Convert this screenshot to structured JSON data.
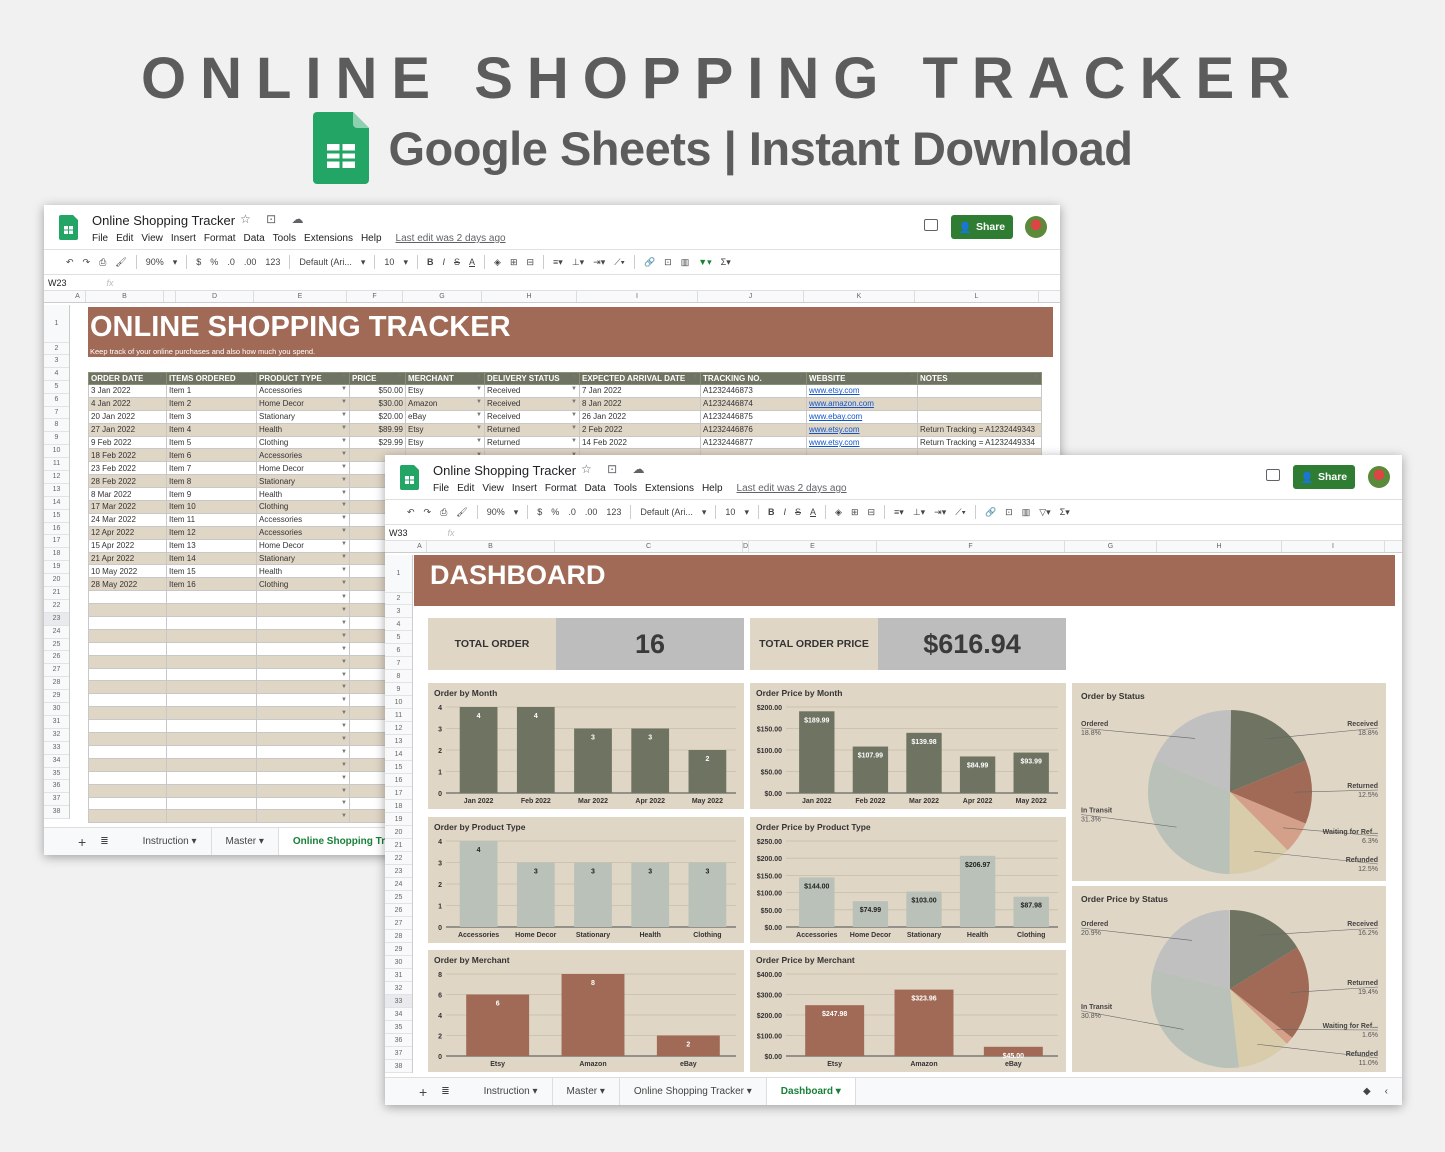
{
  "promo": {
    "title": "ONLINE SHOPPING TRACKER",
    "subtitle": "Google Sheets | Instant Download"
  },
  "window_back": {
    "doc_title": "Online Shopping Tracker",
    "menu": [
      "File",
      "Edit",
      "View",
      "Insert",
      "Format",
      "Data",
      "Tools",
      "Extensions",
      "Help"
    ],
    "last_edit": "Last edit was 2 days ago",
    "share_label": "Share",
    "toolbar": {
      "zoom": "90%",
      "currency": "$",
      "percent": "%",
      "dec_less": ".0",
      "dec_more": ".00",
      "format": "123",
      "font": "Default (Ari...",
      "font_size": "10"
    },
    "cell_ref": "W23",
    "columns": [
      "A",
      "B",
      "",
      "D",
      "E",
      "F",
      "G",
      "H",
      "I",
      "J",
      "K",
      "L"
    ],
    "banner_title": "ONLINE SHOPPING TRACKER",
    "banner_subtitle": "Keep track of your online purchases and also how much you spend.",
    "table_headers": [
      "ORDER DATE",
      "ITEMS ORDERED",
      "PRODUCT TYPE",
      "PRICE",
      "MERCHANT",
      "DELIVERY STATUS",
      "EXPECTED ARRIVAL DATE",
      "TRACKING NO.",
      "WEBSITE",
      "NOTES"
    ],
    "rows": [
      [
        "3 Jan 2022",
        "Item 1",
        "Accessories",
        "$50.00",
        "Etsy",
        "Received",
        "7 Jan 2022",
        "A1232446873",
        "www.etsy.com",
        ""
      ],
      [
        "4 Jan 2022",
        "Item 2",
        "Home Decor",
        "$30.00",
        "Amazon",
        "Received",
        "8 Jan 2022",
        "A1232446874",
        "www.amazon.com",
        ""
      ],
      [
        "20 Jan 2022",
        "Item 3",
        "Stationary",
        "$20.00",
        "eBay",
        "Received",
        "26 Jan 2022",
        "A1232446875",
        "www.ebay.com",
        ""
      ],
      [
        "27 Jan 2022",
        "Item 4",
        "Health",
        "$89.99",
        "Etsy",
        "Returned",
        "2 Feb 2022",
        "A1232446876",
        "www.etsy.com",
        "Return Tracking = A1232449343"
      ],
      [
        "9 Feb 2022",
        "Item 5",
        "Clothing",
        "$29.99",
        "Etsy",
        "Returned",
        "14 Feb 2022",
        "A1232446877",
        "www.etsy.com",
        "Return Tracking = A1232449334"
      ],
      [
        "18 Feb 2022",
        "Item 6",
        "Accessories",
        "",
        "",
        "",
        "",
        "",
        "",
        ""
      ],
      [
        "23 Feb 2022",
        "Item 7",
        "Home Decor",
        "",
        "",
        "",
        "",
        "",
        "",
        ""
      ],
      [
        "28 Feb 2022",
        "Item 8",
        "Stationary",
        "",
        "",
        "",
        "",
        "",
        "",
        ""
      ],
      [
        "8 Mar 2022",
        "Item 9",
        "Health",
        "",
        "",
        "",
        "",
        "",
        "",
        ""
      ],
      [
        "17 Mar 2022",
        "Item 10",
        "Clothing",
        "",
        "",
        "",
        "",
        "",
        "",
        ""
      ],
      [
        "24 Mar 2022",
        "Item 11",
        "Accessories",
        "",
        "",
        "",
        "",
        "",
        "",
        ""
      ],
      [
        "12 Apr 2022",
        "Item 12",
        "Accessories",
        "",
        "",
        "",
        "",
        "",
        "",
        ""
      ],
      [
        "15 Apr 2022",
        "Item 13",
        "Home Decor",
        "",
        "",
        "",
        "",
        "",
        "",
        ""
      ],
      [
        "21 Apr 2022",
        "Item 14",
        "Stationary",
        "",
        "",
        "",
        "",
        "",
        "",
        ""
      ],
      [
        "10 May 2022",
        "Item 15",
        "Health",
        "",
        "",
        "",
        "",
        "",
        "",
        ""
      ],
      [
        "28 May 2022",
        "Item 16",
        "Clothing",
        "",
        "",
        "",
        "",
        "",
        "",
        ""
      ]
    ],
    "sheet_tabs": [
      "Instruction",
      "Master",
      "Online Shopping Trac"
    ]
  },
  "window_front": {
    "doc_title": "Online Shopping Tracker",
    "menu": [
      "File",
      "Edit",
      "View",
      "Insert",
      "Format",
      "Data",
      "Tools",
      "Extensions",
      "Help"
    ],
    "last_edit": "Last edit was 2 days ago",
    "share_label": "Share",
    "toolbar": {
      "zoom": "90%",
      "currency": "$",
      "percent": "%",
      "dec_less": ".0",
      "dec_more": ".00",
      "format": "123",
      "font": "Default (Ari...",
      "font_size": "10"
    },
    "cell_ref": "W33",
    "columns": [
      "A",
      "B",
      "C",
      "D",
      "E",
      "F",
      "G",
      "H",
      "I"
    ],
    "dashboard_title": "DASHBOARD",
    "kpis": {
      "total_order_label": "TOTAL ORDER",
      "total_order_value": "16",
      "total_price_label": "TOTAL ORDER PRICE",
      "total_price_value": "$616.94"
    },
    "sheet_tabs": [
      "Instruction",
      "Master",
      "Online Shopping Tracker",
      "Dashboard"
    ],
    "active_tab": "Dashboard"
  },
  "colors": {
    "brand_brown": "#a06a56",
    "olive": "#6e7362",
    "sage": "#b9c1b8",
    "beige_bg": "#e0d6c6",
    "share_green": "#2e7d32"
  },
  "chart_data": [
    {
      "type": "bar",
      "title": "Order by Month",
      "categories": [
        "Jan 2022",
        "Feb 2022",
        "Mar 2022",
        "Apr 2022",
        "May 2022"
      ],
      "values": [
        4,
        4,
        3,
        3,
        2
      ],
      "labels": [
        "4",
        "4",
        "3",
        "3",
        "2"
      ],
      "yticks": [
        "0",
        "1",
        "2",
        "3",
        "4"
      ],
      "ylim": [
        0,
        4
      ],
      "color": "#6e7362",
      "label_color": "#ffffff"
    },
    {
      "type": "bar",
      "title": "Order Price by Month",
      "categories": [
        "Jan 2022",
        "Feb 2022",
        "Mar 2022",
        "Apr 2022",
        "May 2022"
      ],
      "values": [
        189.99,
        107.99,
        139.98,
        84.99,
        93.99
      ],
      "labels": [
        "$189.99",
        "$107.99",
        "$139.98",
        "$84.99",
        "$93.99"
      ],
      "yticks": [
        "$0.00",
        "$50.00",
        "$100.00",
        "$150.00",
        "$200.00"
      ],
      "ylim": [
        0,
        200
      ],
      "color": "#6e7362",
      "label_color": "#ffffff"
    },
    {
      "type": "bar",
      "title": "Order by Product Type",
      "categories": [
        "Accessories",
        "Home Decor",
        "Stationary",
        "Health",
        "Clothing"
      ],
      "values": [
        4,
        3,
        3,
        3,
        3
      ],
      "labels": [
        "4",
        "3",
        "3",
        "3",
        "3"
      ],
      "yticks": [
        "0",
        "1",
        "2",
        "3",
        "4"
      ],
      "ylim": [
        0,
        4
      ],
      "color": "#b9c1b8",
      "label_color": "#222222"
    },
    {
      "type": "bar",
      "title": "Order Price by Product Type",
      "categories": [
        "Accessories",
        "Home Decor",
        "Stationary",
        "Health",
        "Clothing"
      ],
      "values": [
        144.0,
        74.99,
        103.0,
        206.97,
        87.98
      ],
      "labels": [
        "$144.00",
        "$74.99",
        "$103.00",
        "$206.97",
        "$87.98"
      ],
      "yticks": [
        "$0.00",
        "$50.00",
        "$100.00",
        "$150.00",
        "$200.00",
        "$250.00"
      ],
      "ylim": [
        0,
        250
      ],
      "color": "#b9c1b8",
      "label_color": "#222222"
    },
    {
      "type": "bar",
      "title": "Order by Merchant",
      "categories": [
        "Etsy",
        "Amazon",
        "eBay"
      ],
      "values": [
        6,
        8,
        2
      ],
      "labels": [
        "6",
        "8",
        "2"
      ],
      "yticks": [
        "0",
        "2",
        "4",
        "6",
        "8"
      ],
      "ylim": [
        0,
        8
      ],
      "color": "#a06a56",
      "label_color": "#ffffff"
    },
    {
      "type": "bar",
      "title": "Order Price by Merchant",
      "categories": [
        "Etsy",
        "Amazon",
        "eBay"
      ],
      "values": [
        247.98,
        323.96,
        45.0
      ],
      "labels": [
        "$247.98",
        "$323.96",
        "$45.00"
      ],
      "yticks": [
        "$0.00",
        "$100.00",
        "$200.00",
        "$300.00",
        "$400.00"
      ],
      "ylim": [
        0,
        400
      ],
      "color": "#a06a56",
      "label_color": "#ffffff"
    },
    {
      "type": "pie",
      "title": "Order by Status",
      "slices": [
        {
          "label": "Received",
          "pct": 18.8,
          "display": "18.8%",
          "color": "#6e7362",
          "side": "right"
        },
        {
          "label": "Returned",
          "pct": 12.5,
          "display": "12.5%",
          "color": "#a06a56",
          "side": "right"
        },
        {
          "label": "Waiting for Ref...",
          "pct": 6.3,
          "display": "6.3%",
          "color": "#d4a08a",
          "side": "right"
        },
        {
          "label": "Refunded",
          "pct": 12.5,
          "display": "12.5%",
          "color": "#d8ccaa",
          "side": "right"
        },
        {
          "label": "In Transit",
          "pct": 31.3,
          "display": "31.3%",
          "color": "#b9c1b8",
          "side": "left"
        },
        {
          "label": "Ordered",
          "pct": 18.8,
          "display": "18.8%",
          "color": "#c0c0c0",
          "side": "left"
        }
      ]
    },
    {
      "type": "pie",
      "title": "Order Price by Status",
      "slices": [
        {
          "label": "Received",
          "pct": 16.2,
          "display": "16.2%",
          "color": "#6e7362",
          "side": "right"
        },
        {
          "label": "Returned",
          "pct": 19.4,
          "display": "19.4%",
          "color": "#a06a56",
          "side": "right"
        },
        {
          "label": "Waiting for Ref...",
          "pct": 1.6,
          "display": "1.6%",
          "color": "#d4a08a",
          "side": "right"
        },
        {
          "label": "Refunded",
          "pct": 11.0,
          "display": "11.0%",
          "color": "#d8ccaa",
          "side": "right"
        },
        {
          "label": "In Transit",
          "pct": 30.8,
          "display": "30.8%",
          "color": "#b9c1b8",
          "side": "left"
        },
        {
          "label": "Ordered",
          "pct": 20.9,
          "display": "20.9%",
          "color": "#c0c0c0",
          "side": "left"
        }
      ]
    }
  ]
}
